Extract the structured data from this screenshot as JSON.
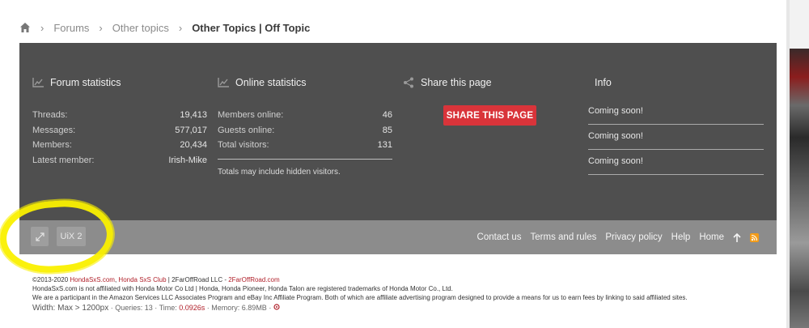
{
  "breadcrumb": {
    "items": [
      "Forums",
      "Other topics"
    ],
    "current": "Other Topics | Off Topic"
  },
  "forum_stats": {
    "title": "Forum statistics",
    "rows": [
      {
        "label": "Threads:",
        "value": "19,413"
      },
      {
        "label": "Messages:",
        "value": "577,017"
      },
      {
        "label": "Members:",
        "value": "20,434"
      },
      {
        "label": "Latest member:",
        "value": "Irish-Mike"
      }
    ]
  },
  "online_stats": {
    "title": "Online statistics",
    "rows": [
      {
        "label": "Members online:",
        "value": "46"
      },
      {
        "label": "Guests online:",
        "value": "85"
      },
      {
        "label": "Total visitors:",
        "value": "131"
      }
    ],
    "note": "Totals may include hidden visitors."
  },
  "share": {
    "title": "Share this page",
    "button": "SHARE THIS PAGE"
  },
  "info": {
    "title": "Info",
    "items": [
      "Coming soon!",
      "Coming soon!",
      "Coming soon!"
    ]
  },
  "footer": {
    "style_button": "UiX 2",
    "links": [
      "Contact us",
      "Terms and rules",
      "Privacy policy",
      "Help",
      "Home"
    ]
  },
  "copyright": {
    "line1_prefix": "©2013-2020 ",
    "site": "HondaSxS.com",
    "sep": ", ",
    "club": "Honda SxS Club",
    "mid": " | 2FarOffRoad LLC - ",
    "company_site": "2FarOffRoad.com",
    "line2": "HondaSxS.com is not affiliated with Honda Motor Co Ltd | Honda, Honda Pioneer, Honda Talon are registered trademarks of Honda Motor Co., Ltd.",
    "line3": "We are a participant in the Amazon Services LLC Associates Program and eBay Inc Affiliate Program. Both of which are affiliate advertising program designed to provide a means for us to earn fees by linking to said affiliated sites.",
    "width_label": "Width: ",
    "width_value": "Max > 1200px",
    "queries": " · Queries: 13 · Time: ",
    "time": "0.0926s",
    "memory": " · Memory: 6.89MB · "
  },
  "colors": {
    "panel": "#4f4f4f",
    "footbar": "#8c8c8c",
    "accent": "#d9343a",
    "highlight": "#faf000"
  }
}
